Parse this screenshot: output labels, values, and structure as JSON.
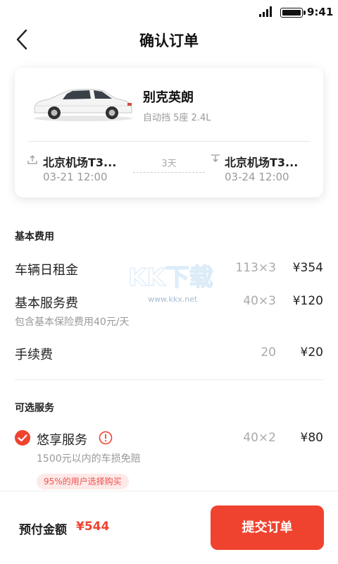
{
  "status_bar": {
    "time": "9:41",
    "signal_icon": "signal-bars-icon",
    "battery_icon": "battery-icon"
  },
  "header": {
    "title": "确认订单",
    "back_icon": "chevron-left-icon"
  },
  "car": {
    "name": "别克英朗",
    "spec": "自动挡 5座 2.4L",
    "pickup": {
      "location": "北京机场T3...",
      "time": "03-21 12:00",
      "icon": "upload-arrow-icon"
    },
    "return": {
      "location": "北京机场T3...",
      "time": "03-24 12:00",
      "icon": "download-arrow-icon"
    },
    "duration": "3天"
  },
  "basic_fees": {
    "title": "基本费用",
    "rows": [
      {
        "label": "车辆日租金",
        "calc": "113×3",
        "amount": "¥354"
      },
      {
        "label": "基本服务费",
        "calc": "40×3",
        "amount": "¥120",
        "note": "包含基本保险费用40元/天"
      },
      {
        "label": "手续费",
        "calc": "20",
        "amount": "¥20"
      }
    ]
  },
  "optional_services": {
    "title": "可选服务",
    "items": [
      {
        "label": "悠享服务",
        "calc": "40×2",
        "amount": "¥80",
        "note": "1500元以内的车损免赔",
        "badge": "95%的用户选择购买",
        "checked": true
      }
    ]
  },
  "footer": {
    "prepay_label": "预付金额",
    "prepay_amount": "¥544",
    "submit_label": "提交订单"
  },
  "watermark": {
    "text": "KK下载",
    "url": "www.kkx.net"
  },
  "colors": {
    "accent": "#f0432f",
    "badge_bg": "#fde9e7",
    "muted": "#999999"
  }
}
